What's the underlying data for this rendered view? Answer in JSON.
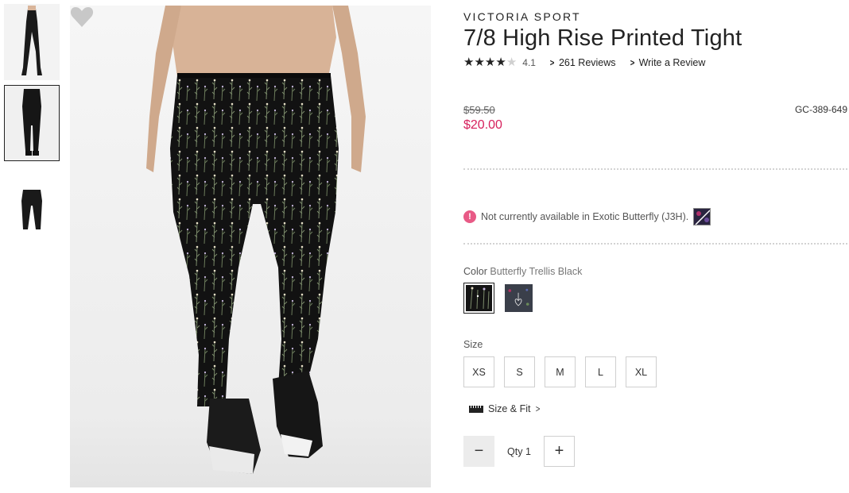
{
  "product": {
    "brand": "VICTORIA SPORT",
    "title": "7/8 High Rise Printed Tight",
    "rating": {
      "value": "4.1",
      "stars_filled": 4,
      "stars_total": 5
    },
    "reviews_link": "261 Reviews",
    "write_review_link": "Write a Review",
    "price_original": "$59.50",
    "price_sale": "$20.00",
    "sku": "GC-389-649"
  },
  "availability": {
    "message": "Not currently available in Exotic Butterfly (J3H).",
    "icon": "alert-icon"
  },
  "color": {
    "label": "Color",
    "selected": "Butterfly Trellis Black",
    "options": [
      "Butterfly Trellis Black",
      "Exotic Butterfly"
    ]
  },
  "size": {
    "label": "Size",
    "options": [
      "XS",
      "S",
      "M",
      "L",
      "XL"
    ]
  },
  "size_fit_link": "Size & Fit",
  "quantity": {
    "label": "Qty",
    "value": "1",
    "minus": "−",
    "plus": "+"
  },
  "colors": {
    "sale_price": "#d6205c",
    "alert": "#e85a86",
    "text": "#222222"
  },
  "icons": {
    "wishlist": "heart-icon",
    "size_fit": "ruler-icon"
  }
}
